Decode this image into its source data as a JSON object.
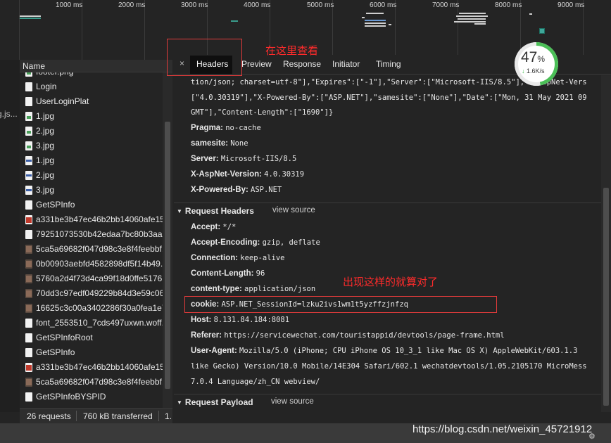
{
  "timeline": {
    "ticks": [
      "1000 ms",
      "2000 ms",
      "3000 ms",
      "4000 ms",
      "5000 ms",
      "6000 ms",
      "7000 ms",
      "8000 ms",
      "9000 ms"
    ]
  },
  "gutter_text": "g.js...",
  "name_panel": {
    "header": "Name",
    "rows": [
      {
        "name": "footer.png",
        "icon": "image-file-icon"
      },
      {
        "name": "Login",
        "icon": "document-file-icon"
      },
      {
        "name": "UserLoginPlat",
        "icon": "document-file-icon"
      },
      {
        "name": "1.jpg",
        "icon": "image-file-icon"
      },
      {
        "name": "2.jpg",
        "icon": "image-file-icon"
      },
      {
        "name": "3.jpg",
        "icon": "image-file-icon"
      },
      {
        "name": "1.jpg",
        "icon": "jpg-file-icon"
      },
      {
        "name": "2.jpg",
        "icon": "jpg-file-icon"
      },
      {
        "name": "3.jpg",
        "icon": "jpg-file-icon"
      },
      {
        "name": "GetSPInfo",
        "icon": "document-file-icon"
      },
      {
        "name": "a331be3b47ec46b2bb14060afe15...",
        "icon": "red-image-icon"
      },
      {
        "name": "79251073530b42edaa7bc80b3aa...",
        "icon": "document-file-icon"
      },
      {
        "name": "5ca5a69682f047d98c3e8f4feebbf...",
        "icon": "photo-icon"
      },
      {
        "name": "0b00903aebfd4582898df5f14b49...",
        "icon": "photo-icon"
      },
      {
        "name": "5760a2d4f73d4ca99f18d0ffe5176...",
        "icon": "photo-icon"
      },
      {
        "name": "70dd3c97edf049229b84d3e59c06...",
        "icon": "photo-icon"
      },
      {
        "name": "16625c3c00a3402286f30a0fea1e7...",
        "icon": "photo-icon"
      },
      {
        "name": "font_2553510_7cds497uxwn.woff...",
        "icon": "document-file-icon"
      },
      {
        "name": "GetSPInfoRoot",
        "icon": "document-file-icon"
      },
      {
        "name": "GetSPInfo",
        "icon": "document-file-icon"
      },
      {
        "name": "a331be3b47ec46b2bb14060afe15...",
        "icon": "red-image-icon"
      },
      {
        "name": "5ca5a69682f047d98c3e8f4feebbf...",
        "icon": "photo-icon"
      },
      {
        "name": "GetSPInfoBYSPID",
        "icon": "document-file-icon"
      }
    ]
  },
  "tabs": {
    "close": "×",
    "headers": "Headers",
    "preview": "Preview",
    "response": "Response",
    "initiator": "Initiator",
    "timing": "Timing"
  },
  "content": {
    "wrap1": "tion/json; charset=utf-8\"],\"Expires\":[\"-1\"],\"Server\":[\"Microsoft-IIS/8.5\"],\"X-AspNet-Vers",
    "wrap2": "[\"4.0.30319\"],\"X-Powered-By\":[\"ASP.NET\"],\"samesite\":[\"None\"],\"Date\":[\"Mon, 31 May 2021 09",
    "wrap3": "GMT\"],\"Content-Length\":[\"1690\"]}",
    "response_headers": [
      {
        "key": "Pragma:",
        "value": "no-cache"
      },
      {
        "key": "samesite:",
        "value": "None"
      },
      {
        "key": "Server:",
        "value": "Microsoft-IIS/8.5"
      },
      {
        "key": "X-AspNet-Version:",
        "value": "4.0.30319"
      },
      {
        "key": "X-Powered-By:",
        "value": "ASP.NET"
      }
    ],
    "request_section": "Request Headers",
    "view_source": "view source",
    "request_headers": [
      {
        "key": "Accept:",
        "value": "*/*"
      },
      {
        "key": "Accept-Encoding:",
        "value": "gzip, deflate"
      },
      {
        "key": "Connection:",
        "value": "keep-alive"
      },
      {
        "key": "Content-Length:",
        "value": "96"
      },
      {
        "key": "content-type:",
        "value": "application/json"
      },
      {
        "key": "cookie:",
        "value": "ASP.NET_SessionId=lzku2ivs1wm1t5yzffzjnfzq"
      },
      {
        "key": "Host:",
        "value": "8.131.84.184:8081"
      },
      {
        "key": "Referer:",
        "value": "https://servicewechat.com/touristappid/devtools/page-frame.html"
      },
      {
        "key": "User-Agent:",
        "value": "Mozilla/5.0 (iPhone; CPU iPhone OS 10_3_1 like Mac OS X) AppleWebKit/603.1.3"
      }
    ],
    "ua_wrap1": "like Gecko) Version/10.0 Mobile/14E304 Safari/602.1 wechatdevtools/1.05.2105170 MicroMess",
    "ua_wrap2": "7.0.4 Language/zh_CN webview/",
    "payload_section": "Request Payload",
    "payload_view_source": "view source"
  },
  "annotations": {
    "look_here": "在这里查看",
    "correct": "出现这样的就算对了"
  },
  "perf_widget": {
    "percent": "47",
    "percent_sign": "%",
    "speed": "1.6K/s",
    "percent_value": 47
  },
  "status_bar": {
    "requests": "26 requests",
    "transferred": "760 kB transferred",
    "extra": "1."
  },
  "watermark": "https://blog.csdn.net/weixin_45721912",
  "colors": {
    "annotation": "#ff2b2b",
    "perf_ring": "#4bbf57",
    "background": "#242424"
  }
}
